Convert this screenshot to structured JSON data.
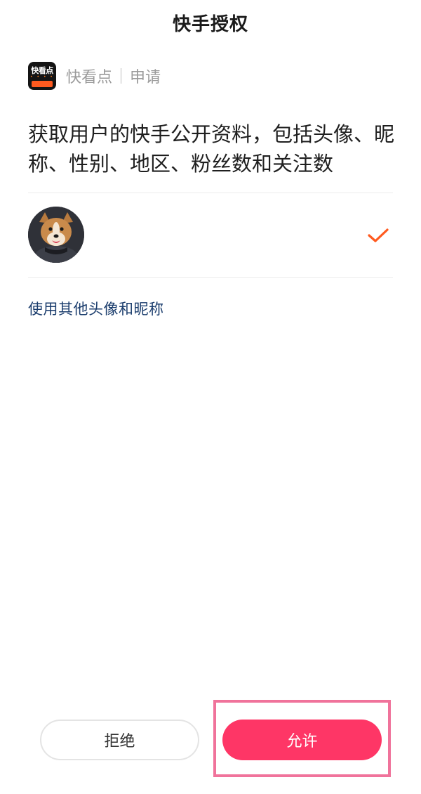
{
  "header": {
    "title": "快手授权"
  },
  "app": {
    "logo_text": "快看点",
    "logo_dots": "• • • •",
    "name": "快看点",
    "action": "申请"
  },
  "permission": {
    "description": "获取用户的快手公开资料，包括头像、昵称、性别、地区、粉丝数和关注数"
  },
  "profile": {
    "avatar_icon": "dog-avatar",
    "selected_icon": "checkmark-icon",
    "check_color": "#ff5a1f"
  },
  "links": {
    "other_profile": "使用其他头像和昵称"
  },
  "buttons": {
    "reject_label": "拒绝",
    "allow_label": "允许"
  },
  "colors": {
    "accent": "#fe3666",
    "highlight": "#f0739b",
    "link": "#1b3d6d"
  }
}
